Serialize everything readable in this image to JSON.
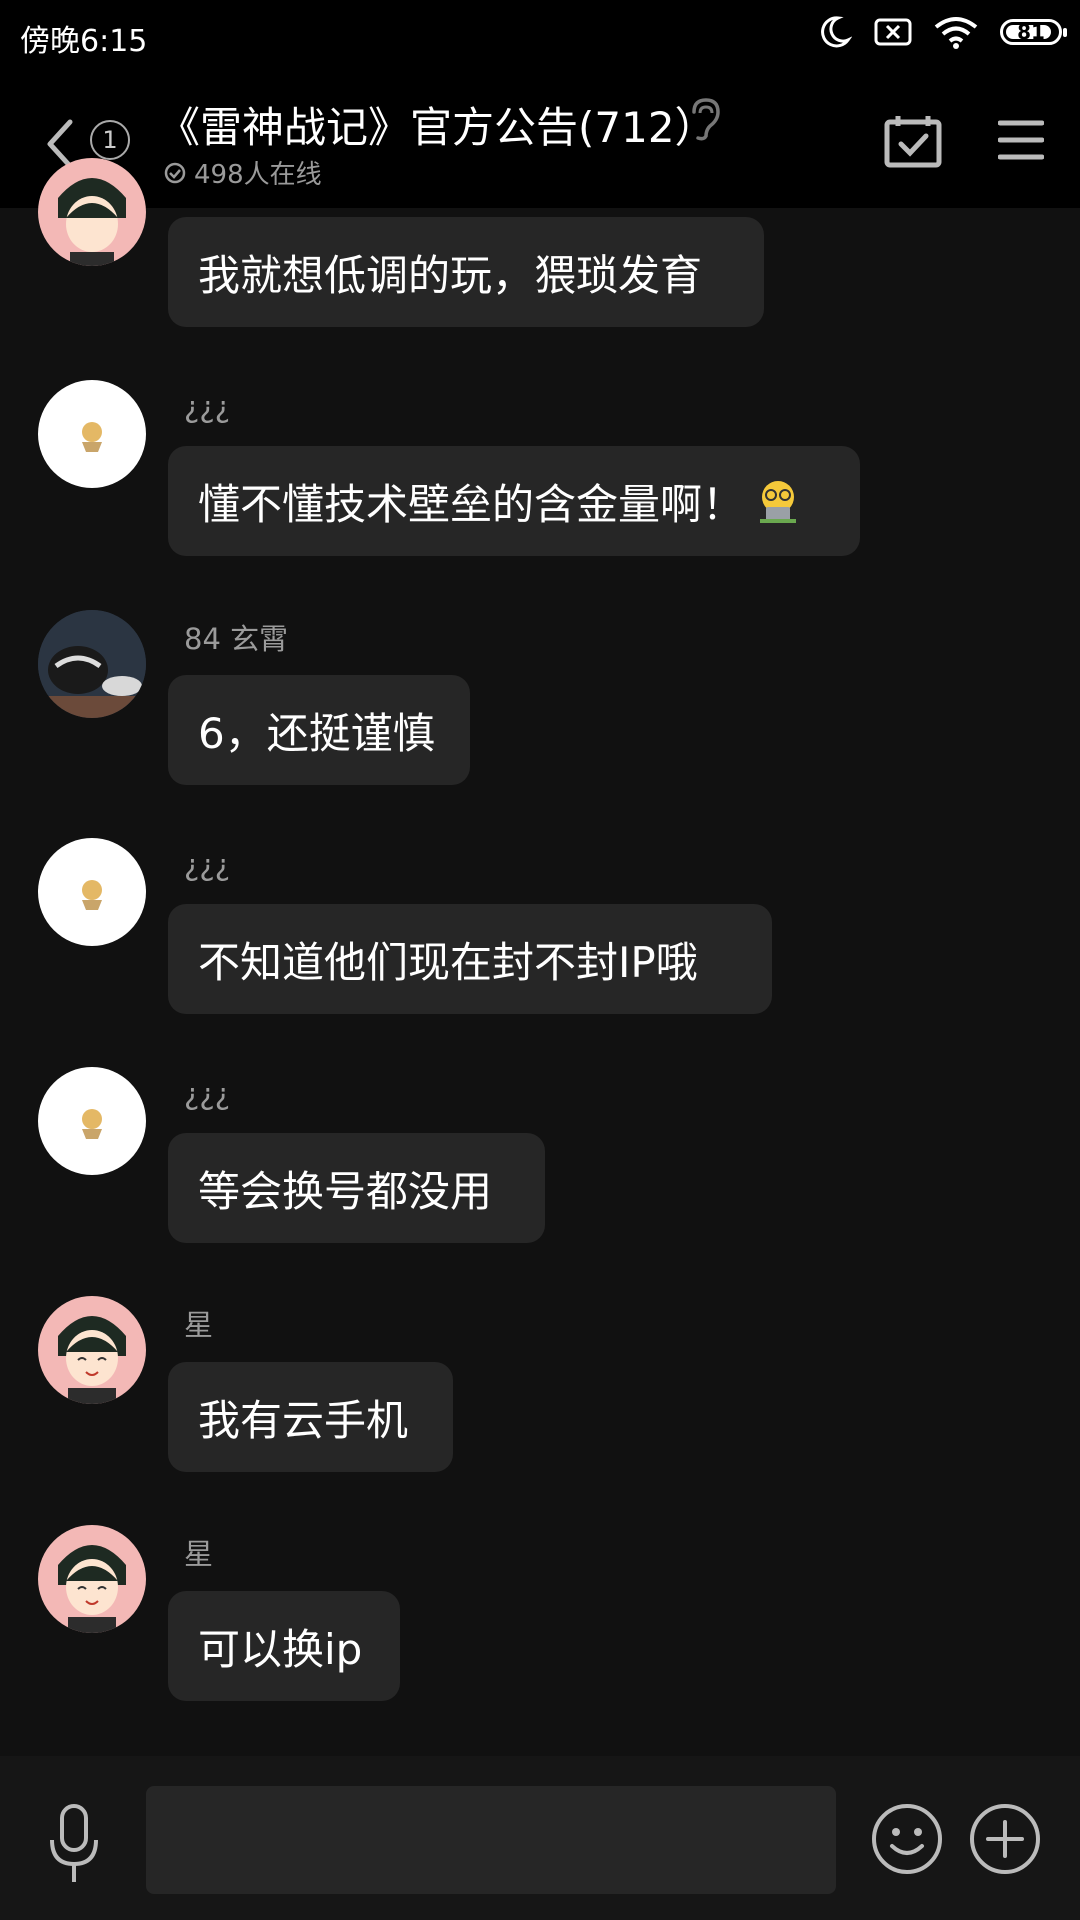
{
  "status_bar": {
    "time": "傍晚6:15",
    "battery": "81"
  },
  "header": {
    "unread_count": "1",
    "title": "《雷神战记》官方公告(712）",
    "online": "498人在线"
  },
  "messages": [
    {
      "sender": "",
      "text": "我就想低调的玩，猥琐发育",
      "avatar": "anime-boy"
    },
    {
      "sender": "¿¿¿",
      "text": "懂不懂技术壁垒的含金量啊！",
      "avatar": "cartoon"
    },
    {
      "sender": "84 玄霄",
      "text": "6，还挺谨慎",
      "avatar": "photo"
    },
    {
      "sender": "¿¿¿",
      "text": "不知道他们现在封不封IP哦",
      "avatar": "cartoon"
    },
    {
      "sender": "¿¿¿",
      "text": "等会换号都没用",
      "avatar": "cartoon"
    },
    {
      "sender": "星",
      "text": "我有云手机",
      "avatar": "anime-boy"
    },
    {
      "sender": "星",
      "text": "可以换ip",
      "avatar": "anime-boy"
    }
  ],
  "colors": {
    "background": "#111111",
    "bubble": "#262626",
    "header": "#000000"
  },
  "icons": [
    "back-arrow-icon",
    "ear-icon",
    "online-check-icon",
    "calendar-check-icon",
    "menu-icon",
    "mic-icon",
    "emoji-icon",
    "plus-icon"
  ]
}
